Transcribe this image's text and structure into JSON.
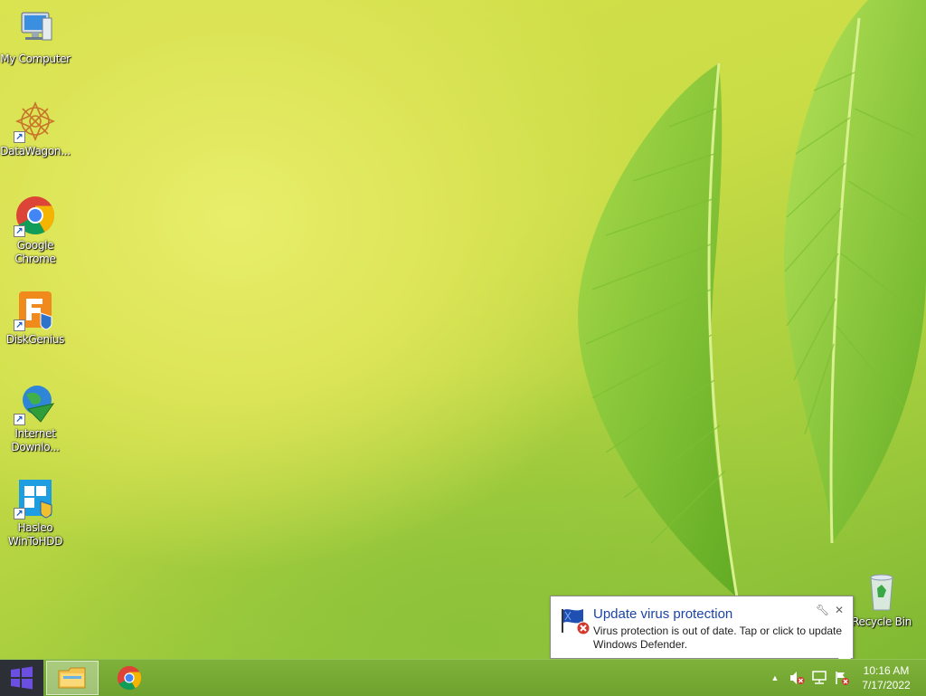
{
  "desktop": {
    "icons": [
      {
        "label": "My Computer",
        "icon": "computer-icon"
      },
      {
        "label": "DataWagon...",
        "icon": "datawagon-icon"
      },
      {
        "label": "Google Chrome",
        "icon": "chrome-icon"
      },
      {
        "label": "DiskGenius",
        "icon": "diskgenius-icon"
      },
      {
        "label": "Internet Downlo...",
        "icon": "internet-download-manager-icon"
      },
      {
        "label": "Hasleo WinToHDD",
        "icon": "wintohdd-icon"
      },
      {
        "label": "Recycle Bin",
        "icon": "recycle-bin-icon"
      }
    ]
  },
  "notification": {
    "title": "Update virus protection",
    "body": "Virus protection is out of date. Tap or click to update Windows Defender.",
    "icon": "shield-flag-error-icon"
  },
  "taskbar": {
    "start_icon": "windows-logo-icon",
    "pinned": [
      {
        "name": "file-explorer",
        "icon": "folder-icon",
        "active": true
      },
      {
        "name": "chrome",
        "icon": "chrome-icon",
        "active": false
      }
    ],
    "tray": {
      "icons": [
        "show-hidden-icons-arrow",
        "volume-muted-icon",
        "network-icon",
        "action-center-flag-error-icon"
      ]
    },
    "clock": {
      "time": "10:16 AM",
      "date": "7/17/2022"
    }
  },
  "colors": {
    "taskbar": "#72a532",
    "start_bg": "#2c2f36",
    "toast_title": "#1b44a8",
    "windows_logo": "#5a3fd1"
  }
}
